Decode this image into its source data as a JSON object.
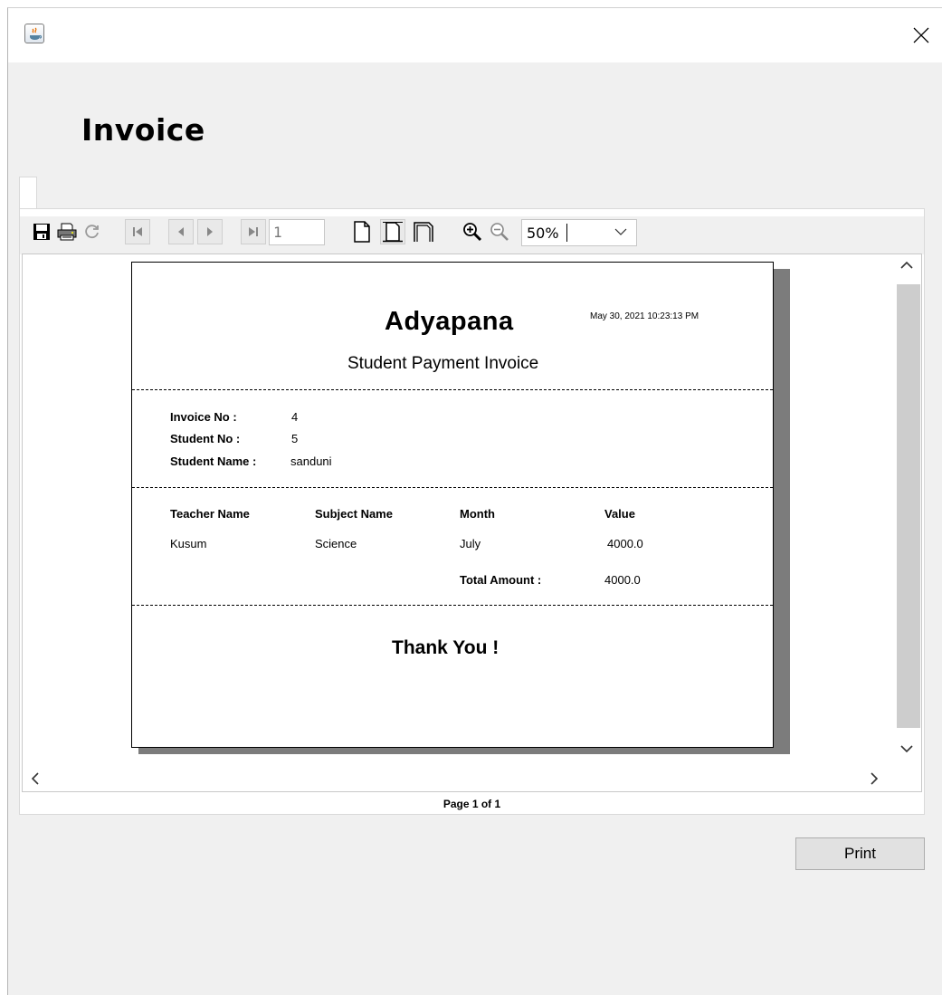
{
  "window": {
    "title": "",
    "close_glyph": "✕"
  },
  "heading": "Invoice",
  "toolbar": {
    "page_number": "1",
    "zoom": "50%",
    "icons": [
      "save-icon",
      "print-icon",
      "reload-icon",
      "first-page-icon",
      "previous-page-icon",
      "next-page-icon",
      "last-page-icon",
      "actual-size-icon",
      "fit-page-icon",
      "fit-width-icon",
      "zoom-in-icon",
      "zoom-out-icon"
    ]
  },
  "report": {
    "company": "Adyapana",
    "subtitle": "Student Payment Invoice",
    "timestamp": "May 30, 2021 10:23:13 PM",
    "invoice_no_label": "Invoice No :",
    "invoice_no": "4",
    "student_no_label": "Student No :",
    "student_no": "5",
    "student_name_label": "Student Name :",
    "student_name": "sanduni",
    "columns": [
      "Teacher Name",
      "Subject Name",
      "Month",
      "Value"
    ],
    "rows": [
      [
        "Kusum",
        "Science",
        "July",
        "4000.0"
      ]
    ],
    "total_label": "Total Amount :",
    "total": "4000.0",
    "thanks": "Thank You !"
  },
  "status": "Page 1 of 1",
  "print_label": "Print"
}
